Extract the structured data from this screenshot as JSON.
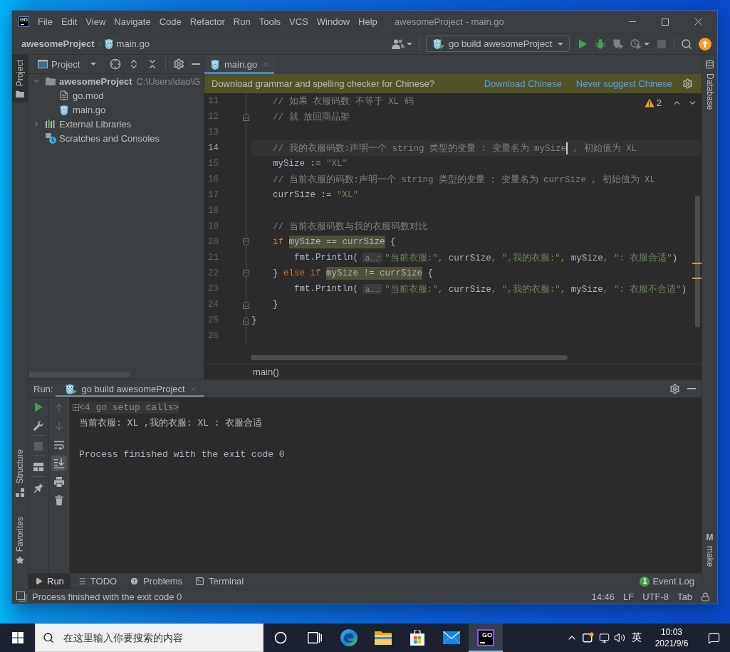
{
  "window": {
    "logo": "GO",
    "menu": [
      "File",
      "Edit",
      "View",
      "Navigate",
      "Code",
      "Refactor",
      "Run",
      "Tools",
      "VCS",
      "Window",
      "Help"
    ],
    "title": "awesomeProject - main.go"
  },
  "navigation_bar": {
    "breadcrumb": [
      {
        "label": "awesomeProject",
        "kind": "project"
      },
      {
        "label": "main.go",
        "kind": "go"
      }
    ],
    "run_configuration": "go build awesomeProject",
    "actions": [
      {
        "kind": "run",
        "disabled": false
      },
      {
        "kind": "debug",
        "disabled": false
      },
      {
        "kind": "coverage",
        "disabled": false
      },
      {
        "kind": "profile",
        "disabled": false
      },
      {
        "kind": "stop",
        "disabled": true
      }
    ]
  },
  "tool_strips": {
    "left_top": [
      {
        "label": "Project",
        "kind": "project",
        "selected": true
      }
    ],
    "left_bottom": [
      {
        "label": "Structure",
        "kind": "structure",
        "selected": false
      },
      {
        "label": "Favorites",
        "kind": "favorites",
        "selected": false
      }
    ],
    "right_top": [
      {
        "label": "Database",
        "kind": "database",
        "selected": false
      }
    ],
    "right_bottom": [
      {
        "label": "make",
        "kind": "make",
        "glyph": "M",
        "selected": false
      }
    ]
  },
  "project_panel": {
    "title": "Project",
    "tree": [
      {
        "label": "awesomeProject",
        "path": "C:\\Users\\dao\\G",
        "kind": "project",
        "expanded": true,
        "children": [
          {
            "label": "go.mod",
            "kind": "file"
          },
          {
            "label": "main.go",
            "kind": "go"
          }
        ]
      },
      {
        "label": "External Libraries",
        "kind": "library",
        "expanded": false
      },
      {
        "label": "Scratches and Consoles",
        "kind": "scratch"
      }
    ]
  },
  "editor": {
    "tabs": [
      {
        "label": "main.go",
        "selected": true
      }
    ],
    "banner": {
      "text": "Download grammar and spelling checker for Chinese?",
      "links": [
        "Download Chinese",
        "Never suggest Chinese"
      ]
    },
    "warnings": "2",
    "lines": [
      {
        "number": "11",
        "current": false,
        "code": [
          {
            "kind": "comment",
            "text": "    // 如果 衣服码数 不等于 XL 码"
          }
        ]
      },
      {
        "number": "12",
        "current": false,
        "fold_marker": {
          "kind": "end"
        },
        "code": [
          {
            "kind": "comment",
            "text": "    // 就 放回商品架"
          }
        ]
      },
      {
        "number": "13",
        "current": false
      },
      {
        "number": "14",
        "current": true,
        "code": [
          {
            "kind": "comment",
            "text": "    // 我的衣服码数:声明一个 string 类型的变量 : 变量名为 mySize",
            "caret": true
          },
          {
            "kind": "comment",
            "text": " , 初始值为 XL"
          }
        ]
      },
      {
        "number": "15",
        "current": false,
        "code": [
          {
            "kind": "plain",
            "text": "    mySize := "
          },
          {
            "kind": "string",
            "text": "\"XL\""
          }
        ]
      },
      {
        "number": "16",
        "current": false,
        "code": [
          {
            "kind": "comment",
            "text": "    // 当前衣服的码数:声明一个 string 类型的变量 : 变量名为 currSize , 初始值为 XL"
          }
        ]
      },
      {
        "number": "17",
        "current": false,
        "code": [
          {
            "kind": "plain",
            "text": "    currSize := "
          },
          {
            "kind": "string",
            "text": "\"XL\""
          }
        ]
      },
      {
        "number": "18",
        "current": false
      },
      {
        "number": "19",
        "current": false,
        "code": [
          {
            "kind": "comment",
            "text": "    // 当前衣服码数与我的衣服码数对比"
          }
        ]
      },
      {
        "number": "20",
        "current": false,
        "fold_marker": {
          "kind": "start"
        },
        "code": [
          {
            "kind": "keyword",
            "text": "    if "
          },
          {
            "kind": "usage",
            "text": "mySize == currSize"
          },
          {
            "kind": "plain",
            "text": " {"
          }
        ]
      },
      {
        "number": "21",
        "current": false,
        "code": [
          {
            "kind": "plain",
            "text": "        fmt.Println("
          },
          {
            "kind": "hint",
            "text": "a…:"
          },
          {
            "kind": "string",
            "text": "\"当前衣服:\""
          },
          {
            "kind": "punct",
            "text": ","
          },
          {
            "kind": "plain",
            "text": " currSize"
          },
          {
            "kind": "punct",
            "text": ","
          },
          {
            "kind": "string",
            "text": " \",我的衣服:\""
          },
          {
            "kind": "punct",
            "text": ","
          },
          {
            "kind": "plain",
            "text": " mySize"
          },
          {
            "kind": "punct",
            "text": ","
          },
          {
            "kind": "string",
            "text": " \": 衣服合适\""
          },
          {
            "kind": "plain",
            "text": ")"
          }
        ]
      },
      {
        "number": "22",
        "current": false,
        "fold_marker": {
          "kind": "start"
        },
        "code": [
          {
            "kind": "plain",
            "text": "    } "
          },
          {
            "kind": "keyword",
            "text": "else if "
          },
          {
            "kind": "usage",
            "text": "mySize != currSize"
          },
          {
            "kind": "plain",
            "text": " {"
          }
        ]
      },
      {
        "number": "23",
        "current": false,
        "code": [
          {
            "kind": "plain",
            "text": "        fmt.Println("
          },
          {
            "kind": "hint",
            "text": "a…:"
          },
          {
            "kind": "string",
            "text": "\"当前衣服:\""
          },
          {
            "kind": "punct",
            "text": ","
          },
          {
            "kind": "plain",
            "text": " currSize"
          },
          {
            "kind": "punct",
            "text": ","
          },
          {
            "kind": "string",
            "text": " \",我的衣服:\""
          },
          {
            "kind": "punct",
            "text": ","
          },
          {
            "kind": "plain",
            "text": " mySize"
          },
          {
            "kind": "punct",
            "text": ","
          },
          {
            "kind": "string",
            "text": " \": 衣服不合适\""
          },
          {
            "kind": "plain",
            "text": ")"
          }
        ]
      },
      {
        "number": "24",
        "current": false,
        "fold_marker": {
          "kind": "end"
        },
        "code": [
          {
            "kind": "plain",
            "text": "    }"
          }
        ]
      },
      {
        "number": "25",
        "current": false,
        "fold_marker": {
          "kind": "end"
        },
        "code": [
          {
            "kind": "plain",
            "text": "}"
          }
        ]
      },
      {
        "number": "26",
        "current": false
      }
    ],
    "breadcrumb": "main()"
  },
  "run_panel": {
    "label": "Run:",
    "tabs": [
      {
        "label": "go build awesomeProject",
        "selected": true
      }
    ],
    "actions": [
      {
        "kind": "rerun",
        "disabled": false
      },
      {
        "kind": "wrench",
        "disabled": false
      },
      {
        "kind": "stop",
        "disabled": true
      },
      {
        "kind": "layout",
        "disabled": false
      },
      {
        "kind": "pin",
        "disabled": false
      }
    ],
    "console_tools": [
      {
        "kind": "up",
        "disabled": true,
        "selected": false
      },
      {
        "kind": "down",
        "disabled": true,
        "selected": false
      },
      {
        "kind": "wrap",
        "disabled": false,
        "selected": false
      },
      {
        "kind": "scroll_end",
        "disabled": false,
        "selected": true
      },
      {
        "kind": "print",
        "disabled": false,
        "selected": false
      },
      {
        "kind": "clear",
        "disabled": false,
        "selected": false
      }
    ],
    "console": [
      {
        "kind": "folded",
        "text": "<4 go setup calls>"
      },
      {
        "kind": "output",
        "text": "当前衣服: XL ,我的衣服: XL : 衣服合适"
      },
      {
        "kind": "blank"
      },
      {
        "kind": "system",
        "text": "Process finished with the exit code 0"
      }
    ]
  },
  "tool_tabs": {
    "tabs": [
      {
        "label": "Run",
        "kind": "run",
        "selected": true
      },
      {
        "label": "TODO",
        "kind": "todo",
        "selected": false
      },
      {
        "label": "Problems",
        "kind": "problems",
        "selected": false
      },
      {
        "label": "Terminal",
        "kind": "terminal",
        "selected": false
      }
    ],
    "event_log": {
      "label": "Event Log",
      "count": "1"
    }
  },
  "status_bar": {
    "message": "Process finished with the exit code 0",
    "items": [
      "14:46",
      "LF",
      "UTF-8",
      "Tab"
    ]
  },
  "taskbar": {
    "search": {
      "placeholder": "在这里输入你要搜索的内容"
    },
    "apps": [
      {
        "kind": "edge",
        "selected": false
      },
      {
        "kind": "explorer",
        "selected": false
      },
      {
        "kind": "store",
        "selected": false
      },
      {
        "kind": "mail",
        "selected": false
      },
      {
        "kind": "goland",
        "label": "GO",
        "selected": true
      }
    ],
    "tray": {
      "input_method": "英",
      "time": "10:03",
      "date": "2021/9/6"
    }
  }
}
